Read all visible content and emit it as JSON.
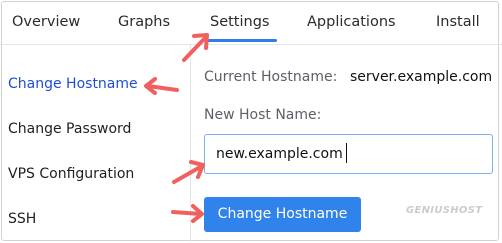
{
  "tabs": [
    {
      "label": "Overview"
    },
    {
      "label": "Graphs"
    },
    {
      "label": "Settings"
    },
    {
      "label": "Applications"
    },
    {
      "label": "Install"
    }
  ],
  "sidebar": {
    "items": [
      {
        "label": "Change Hostname"
      },
      {
        "label": "Change Password"
      },
      {
        "label": "VPS Configuration"
      },
      {
        "label": "SSH"
      }
    ]
  },
  "form": {
    "current_label": "Current Hostname:",
    "current_value": "server.example.com",
    "new_label": "New Host Name:",
    "new_value": "new.example.com",
    "submit_label": "Change Hostname"
  },
  "watermark": "GENIUSHOST",
  "colors": {
    "accent": "#2f83ea",
    "active_link": "#1f4fd1",
    "annotation_arrow": "#f0605d"
  }
}
